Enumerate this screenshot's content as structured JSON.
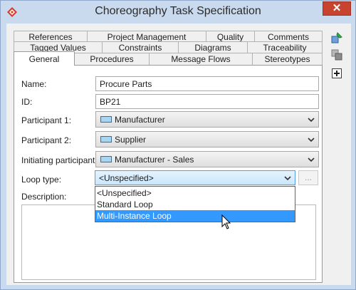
{
  "window": {
    "title": "Choreography Task Specification",
    "close_glyph": "✕"
  },
  "tabs": {
    "row1": [
      "References",
      "Project Management",
      "Quality",
      "Comments"
    ],
    "row2": [
      "Tagged Values",
      "Constraints",
      "Diagrams",
      "Traceability"
    ],
    "row3": [
      "General",
      "Procedures",
      "Message Flows",
      "Stereotypes"
    ],
    "active": "General"
  },
  "form": {
    "name_label": "Name:",
    "name_value": "Procure Parts",
    "id_label": "ID:",
    "id_value": "BP21",
    "participant1_label": "Participant 1:",
    "participant1_value": "Manufacturer",
    "participant2_label": "Participant 2:",
    "participant2_value": "Supplier",
    "initiating_label": "Initiating participant:",
    "initiating_value": "Manufacturer - Sales",
    "loop_type_label": "Loop type:",
    "loop_type_value": "<Unspecified>",
    "ellipsis_label": "...",
    "description_label": "Description:"
  },
  "loop_dropdown": {
    "options": [
      "<Unspecified>",
      "Standard Loop",
      "Multi-Instance Loop"
    ],
    "highlighted": "Multi-Instance Loop"
  },
  "icons": {
    "app": "visual-paradigm-icon",
    "side": [
      "pin-icon",
      "layers-icon",
      "add-icon"
    ]
  },
  "colors": {
    "title_bg": "#c9d9ee",
    "close_bg": "#c7432f",
    "selection": "#3399ff",
    "swatch": "#a8d6f2"
  }
}
